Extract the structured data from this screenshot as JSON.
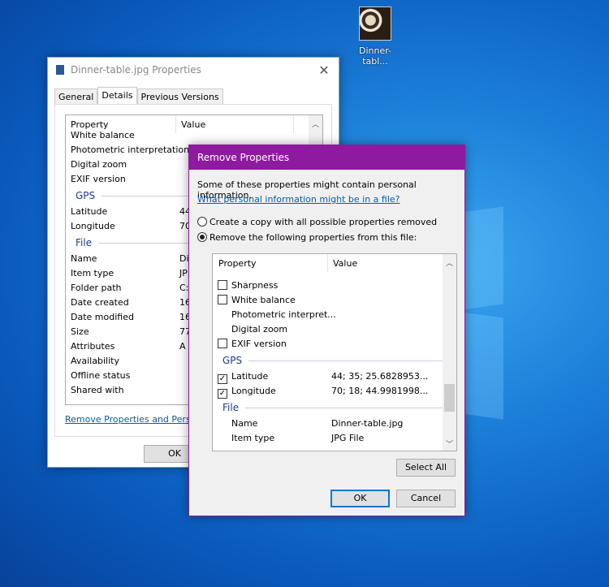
{
  "desktop": {
    "icon_label": "Dinner-tabl..."
  },
  "properties": {
    "title": "Dinner-table.jpg Properties",
    "tabs": [
      "General",
      "Details",
      "Previous Versions"
    ],
    "columns": [
      "Property",
      "Value"
    ],
    "rows": [
      {
        "type": "item",
        "name": "White balance",
        "value": ""
      },
      {
        "type": "item",
        "name": "Photometric interpretation",
        "value": ""
      },
      {
        "type": "item",
        "name": "Digital zoom",
        "value": ""
      },
      {
        "type": "item",
        "name": "EXIF version",
        "value": ""
      },
      {
        "type": "group",
        "name": "GPS"
      },
      {
        "type": "item",
        "name": "Latitude",
        "value": "44"
      },
      {
        "type": "item",
        "name": "Longitude",
        "value": "70"
      },
      {
        "type": "group",
        "name": "File"
      },
      {
        "type": "item",
        "name": "Name",
        "value": "Di"
      },
      {
        "type": "item",
        "name": "Item type",
        "value": "JP"
      },
      {
        "type": "item",
        "name": "Folder path",
        "value": "C:"
      },
      {
        "type": "item",
        "name": "Date created",
        "value": "16"
      },
      {
        "type": "item",
        "name": "Date modified",
        "value": "16"
      },
      {
        "type": "item",
        "name": "Size",
        "value": "77"
      },
      {
        "type": "item",
        "name": "Attributes",
        "value": "A"
      },
      {
        "type": "item",
        "name": "Availability",
        "value": ""
      },
      {
        "type": "item",
        "name": "Offline status",
        "value": ""
      },
      {
        "type": "item",
        "name": "Shared with",
        "value": ""
      }
    ],
    "remove_link": "Remove Properties and Persona",
    "ok": "OK"
  },
  "remove_dialog": {
    "title": "Remove Properties",
    "intro": "Some of these properties might contain personal information.",
    "info_link": "What personal information might be in a file?",
    "option_copy": "Create a copy with all possible properties removed",
    "option_remove": "Remove the following properties from this file:",
    "selected_option": "remove",
    "columns": [
      "Property",
      "Value"
    ],
    "rows": [
      {
        "type": "item",
        "name": "Sharpness",
        "value": "",
        "checkbox": true,
        "checked": false
      },
      {
        "type": "item",
        "name": "White balance",
        "value": "",
        "checkbox": true,
        "checked": false
      },
      {
        "type": "item",
        "name": "Photometric interpret...",
        "value": "",
        "checkbox": false
      },
      {
        "type": "item",
        "name": "Digital zoom",
        "value": "",
        "checkbox": false
      },
      {
        "type": "item",
        "name": "EXIF version",
        "value": "",
        "checkbox": true,
        "checked": false
      },
      {
        "type": "group",
        "name": "GPS"
      },
      {
        "type": "item",
        "name": "Latitude",
        "value": "44; 35; 25.6828953...",
        "checkbox": true,
        "checked": true
      },
      {
        "type": "item",
        "name": "Longitude",
        "value": "70; 18; 44.9981998...",
        "checkbox": true,
        "checked": true
      },
      {
        "type": "group",
        "name": "File"
      },
      {
        "type": "item",
        "name": "Name",
        "value": "Dinner-table.jpg",
        "checkbox": false
      },
      {
        "type": "item",
        "name": "Item type",
        "value": "JPG File",
        "checkbox": false
      }
    ],
    "select_all": "Select All",
    "ok": "OK",
    "cancel": "Cancel",
    "accent": "#8e1aa0"
  }
}
